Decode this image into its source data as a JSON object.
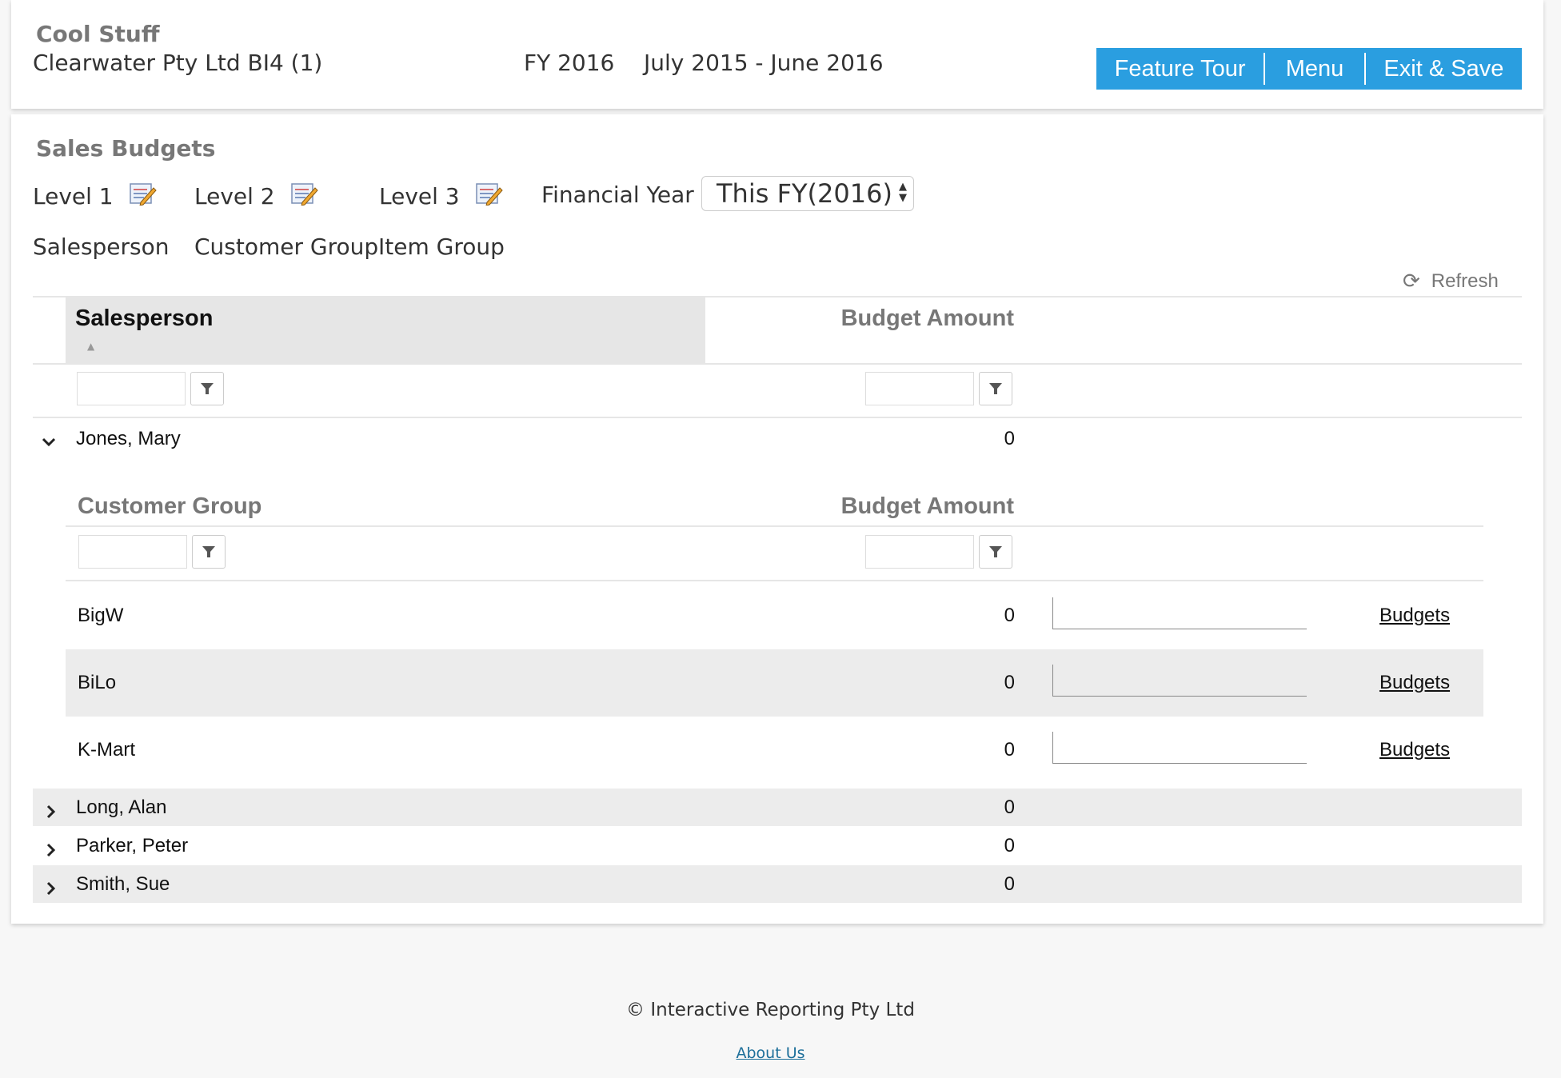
{
  "header": {
    "company": "Cool Stuff",
    "entity": "Clearwater Pty Ltd BI4 (1)",
    "fy": "FY 2016",
    "period": "July 2015 - June 2016",
    "buttons": {
      "feature_tour": "Feature Tour",
      "menu": "Menu",
      "exit_save": "Exit & Save"
    },
    "accent": "#2a9ee0"
  },
  "budgets": {
    "title": "Sales Budgets",
    "levels": [
      {
        "label": "Level 1",
        "value": "Salesperson"
      },
      {
        "label": "Level 2",
        "value": "Customer Group"
      },
      {
        "label": "Level 3",
        "value": "Item Group"
      }
    ],
    "financial_year_label": "Financial Year",
    "financial_year_selected": "This FY(2016)",
    "refresh_label": "Refresh"
  },
  "grid": {
    "col_salesperson": "Salesperson",
    "col_budget": "Budget Amount",
    "expanded": {
      "name": "Jones, Mary",
      "amount": "0",
      "sub_col_group": "Customer Group",
      "sub_col_budget": "Budget Amount",
      "rows": [
        {
          "name": "BigW",
          "amount": "0",
          "link": "Budgets"
        },
        {
          "name": "BiLo",
          "amount": "0",
          "link": "Budgets"
        },
        {
          "name": "K-Mart",
          "amount": "0",
          "link": "Budgets"
        }
      ]
    },
    "collapsed": [
      {
        "name": "Long, Alan",
        "amount": "0"
      },
      {
        "name": "Parker, Peter",
        "amount": "0"
      },
      {
        "name": "Smith, Sue",
        "amount": "0"
      }
    ]
  },
  "footer": {
    "copyright": "© Interactive Reporting Pty Ltd",
    "about": "About Us"
  }
}
